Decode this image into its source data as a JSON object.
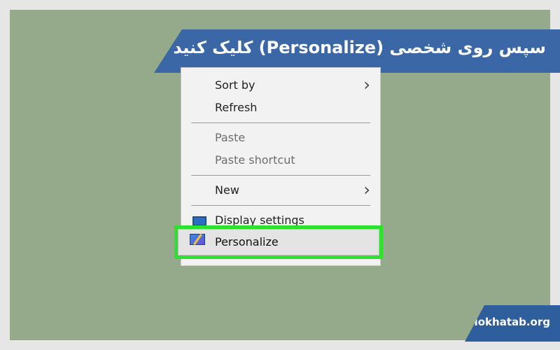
{
  "banner": {
    "text": "سپس روی شخصی (Personalize) کلیک کنید"
  },
  "menu": {
    "items": [
      {
        "label": "Sort by",
        "submenu": true,
        "enabled": true
      },
      {
        "label": "Refresh",
        "submenu": false,
        "enabled": true
      },
      {
        "label": "Paste",
        "submenu": false,
        "enabled": false
      },
      {
        "label": "Paste shortcut",
        "submenu": false,
        "enabled": false
      },
      {
        "label": "New",
        "submenu": true,
        "enabled": true
      },
      {
        "label": "Display settings",
        "icon": "display-icon",
        "enabled": true
      },
      {
        "label": "Personalize",
        "icon": "personalize-icon",
        "enabled": true,
        "highlighted": true
      }
    ]
  },
  "watermark": {
    "text": "Mokhatab.org"
  },
  "colors": {
    "desktop": "#95aa8a",
    "banner": "#3c67a6",
    "highlight": "#2fe12f",
    "menu": "#f2f2f2"
  }
}
